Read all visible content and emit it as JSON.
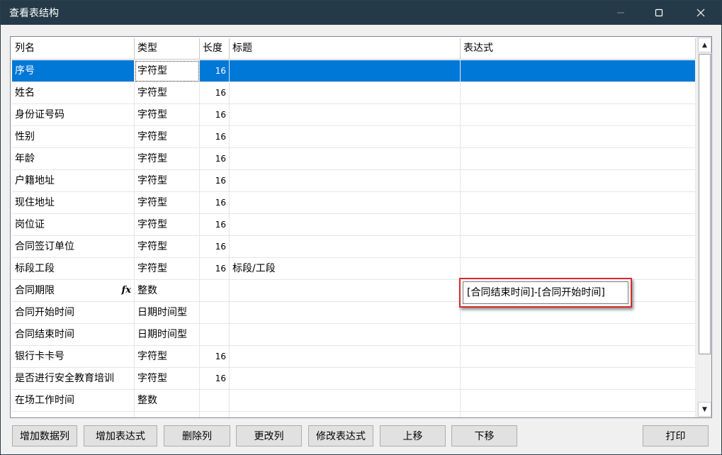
{
  "window": {
    "title": "查看表结构"
  },
  "columns": [
    "列名",
    "类型",
    "长度",
    "标题",
    "表达式"
  ],
  "rows": [
    {
      "name": "序号",
      "type": "字符型",
      "length": "16",
      "caption": "",
      "expr": ""
    },
    {
      "name": "姓名",
      "type": "字符型",
      "length": "16",
      "caption": "",
      "expr": ""
    },
    {
      "name": "身份证号码",
      "type": "字符型",
      "length": "16",
      "caption": "",
      "expr": ""
    },
    {
      "name": "性别",
      "type": "字符型",
      "length": "16",
      "caption": "",
      "expr": ""
    },
    {
      "name": "年龄",
      "type": "字符型",
      "length": "16",
      "caption": "",
      "expr": ""
    },
    {
      "name": "户籍地址",
      "type": "字符型",
      "length": "16",
      "caption": "",
      "expr": ""
    },
    {
      "name": "现住地址",
      "type": "字符型",
      "length": "16",
      "caption": "",
      "expr": ""
    },
    {
      "name": "岗位证",
      "type": "字符型",
      "length": "16",
      "caption": "",
      "expr": ""
    },
    {
      "name": "合同签订单位",
      "type": "字符型",
      "length": "16",
      "caption": "",
      "expr": ""
    },
    {
      "name": "标段工段",
      "type": "字符型",
      "length": "16",
      "caption": "标段/工段",
      "expr": ""
    },
    {
      "name": "合同期限",
      "type": "整数",
      "length": "",
      "caption": "",
      "expr": "",
      "fx": "fx"
    },
    {
      "name": "合同开始时间",
      "type": "日期时间型",
      "length": "",
      "caption": "",
      "expr": ""
    },
    {
      "name": "合同结束时间",
      "type": "日期时间型",
      "length": "",
      "caption": "",
      "expr": ""
    },
    {
      "name": "银行卡卡号",
      "type": "字符型",
      "length": "16",
      "caption": "",
      "expr": ""
    },
    {
      "name": "是否进行安全教育培训",
      "type": "字符型",
      "length": "16",
      "caption": "",
      "expr": ""
    },
    {
      "name": "在场工作时间",
      "type": "整数",
      "length": "",
      "caption": "",
      "expr": ""
    }
  ],
  "selected_row": 0,
  "expression_editor": {
    "value": "[合同结束时间]-[合同开始时间]"
  },
  "buttons": {
    "add_data_column": "增加数据列",
    "add_expression": "增加表达式",
    "delete_column": "删除列",
    "change_column": "更改列",
    "edit_expression": "修改表达式",
    "move_up": "上移",
    "move_down": "下移",
    "print": "打印"
  },
  "icons": {
    "minimize": "minimize-icon",
    "maximize": "maximize-icon",
    "close": "close-icon",
    "fx": "function-icon"
  }
}
